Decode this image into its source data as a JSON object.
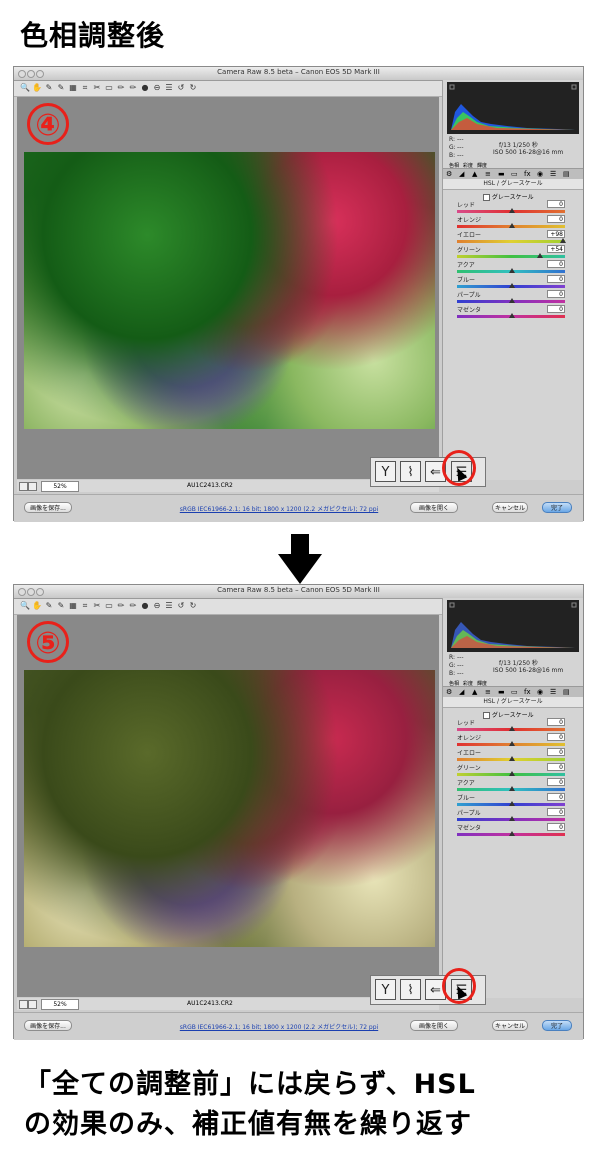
{
  "heading": "色相調整後",
  "caption": {
    "line1": "「全ての調整前」には戻らず、HSL",
    "line2": "の効果のみ、補正値有無を繰り返す"
  },
  "colors": {
    "accent_red": "#e8211a",
    "link_blue": "#1a3fb0"
  },
  "windows": [
    {
      "badge": "④",
      "title": "Camera Raw 8.5 beta  –  Canon EOS 5D Mark III",
      "exif": {
        "aperture_shutter": "f/13    1/250 秒",
        "iso_lens": "ISO 500    16-28@16 mm",
        "r": "R:",
        "g": "G:",
        "b": "B:",
        "dashes": "---"
      },
      "panel_title": "HSL / グレースケール",
      "grayscale_label": "グレースケール",
      "tabs": [
        "色相",
        "彩度",
        "輝度"
      ],
      "default_link": "初期設定",
      "sliders": [
        {
          "label": "レッド",
          "value": "0",
          "pos": 0.5
        },
        {
          "label": "オレンジ",
          "value": "0",
          "pos": 0.5
        },
        {
          "label": "イエロー",
          "value": "+98",
          "pos": 0.99
        },
        {
          "label": "グリーン",
          "value": "+54",
          "pos": 0.77
        },
        {
          "label": "アクア",
          "value": "0",
          "pos": 0.5
        },
        {
          "label": "ブルー",
          "value": "0",
          "pos": 0.5
        },
        {
          "label": "パープル",
          "value": "0",
          "pos": 0.5
        },
        {
          "label": "マゼンタ",
          "value": "0",
          "pos": 0.5
        }
      ],
      "zoom": "52%",
      "filename": "AU1C2413.CR2",
      "save_button": "画像を保存...",
      "workflow_link": "sRGB IEC61966-2.1; 16 bit; 1800 x 1200 (2.2 メガピクセル); 72 ppi",
      "open_button": "画像を開く",
      "cancel_button": "キャンセル",
      "done_button": "完了"
    },
    {
      "badge": "⑤",
      "title": "Camera Raw 8.5 beta  –  Canon EOS 5D Mark III",
      "exif": {
        "aperture_shutter": "f/13    1/250 秒",
        "iso_lens": "ISO 500    16-28@16 mm",
        "r": "R:",
        "g": "G:",
        "b": "B:",
        "dashes": "---"
      },
      "panel_title": "HSL / グレースケール",
      "grayscale_label": "グレースケール",
      "tabs": [
        "色相",
        "彩度",
        "輝度"
      ],
      "default_link": "初期設定",
      "sliders": [
        {
          "label": "レッド",
          "value": "0",
          "pos": 0.5
        },
        {
          "label": "オレンジ",
          "value": "0",
          "pos": 0.5
        },
        {
          "label": "イエロー",
          "value": "0",
          "pos": 0.5
        },
        {
          "label": "グリーン",
          "value": "0",
          "pos": 0.5
        },
        {
          "label": "アクア",
          "value": "0",
          "pos": 0.5
        },
        {
          "label": "ブルー",
          "value": "0",
          "pos": 0.5
        },
        {
          "label": "パープル",
          "value": "0",
          "pos": 0.5
        },
        {
          "label": "マゼンタ",
          "value": "0",
          "pos": 0.5
        }
      ],
      "zoom": "52%",
      "filename": "AU1C2413.CR2",
      "save_button": "画像を保存...",
      "workflow_link": "sRGB IEC61966-2.1; 16 bit; 1800 x 1200 (2.2 メガピクセル); 72 ppi",
      "open_button": "画像を開く",
      "cancel_button": "キャンセル",
      "done_button": "完了"
    }
  ]
}
